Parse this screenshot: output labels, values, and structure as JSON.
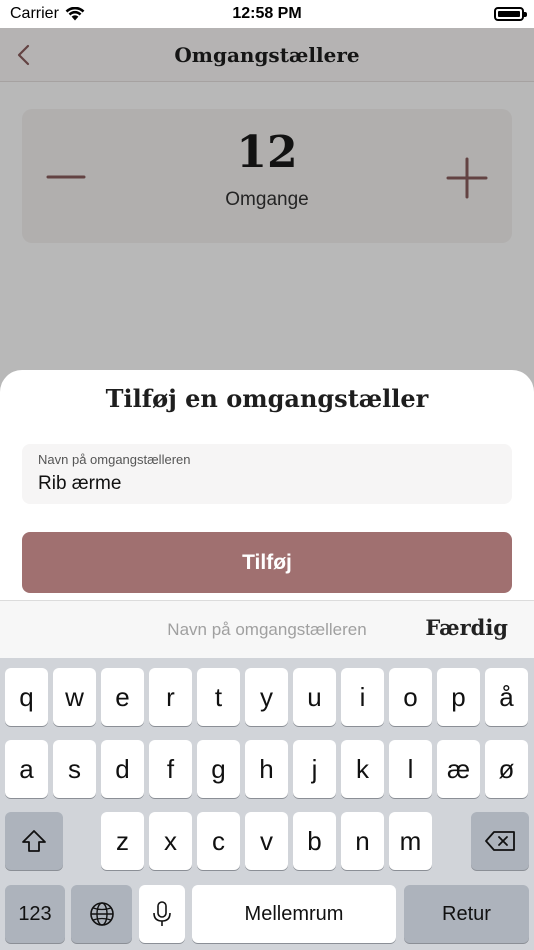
{
  "status_bar": {
    "carrier": "Carrier",
    "time": "12:58 PM"
  },
  "nav": {
    "title": "Omgangstællere"
  },
  "counter": {
    "value": "12",
    "label": "Omgange"
  },
  "sheet": {
    "title": "Tilføj en omgangstæller",
    "field_label": "Navn på omgangstælleren",
    "field_value": "Rib ærme",
    "add_button": "Tilføj"
  },
  "accessory": {
    "placeholder": "Navn på omgangstælleren",
    "done_label": "Færdig"
  },
  "keyboard": {
    "row1": [
      "q",
      "w",
      "e",
      "r",
      "t",
      "y",
      "u",
      "i",
      "o",
      "p",
      "å"
    ],
    "row2": [
      "a",
      "s",
      "d",
      "f",
      "g",
      "h",
      "j",
      "k",
      "l",
      "æ",
      "ø"
    ],
    "row3": [
      "z",
      "x",
      "c",
      "v",
      "b",
      "n",
      "m"
    ],
    "numbers_label": "123",
    "space_label": "Mellemrum",
    "return_label": "Retur"
  },
  "colors": {
    "accent": "#a07070",
    "keyboard_bg": "#d1d4d9"
  }
}
